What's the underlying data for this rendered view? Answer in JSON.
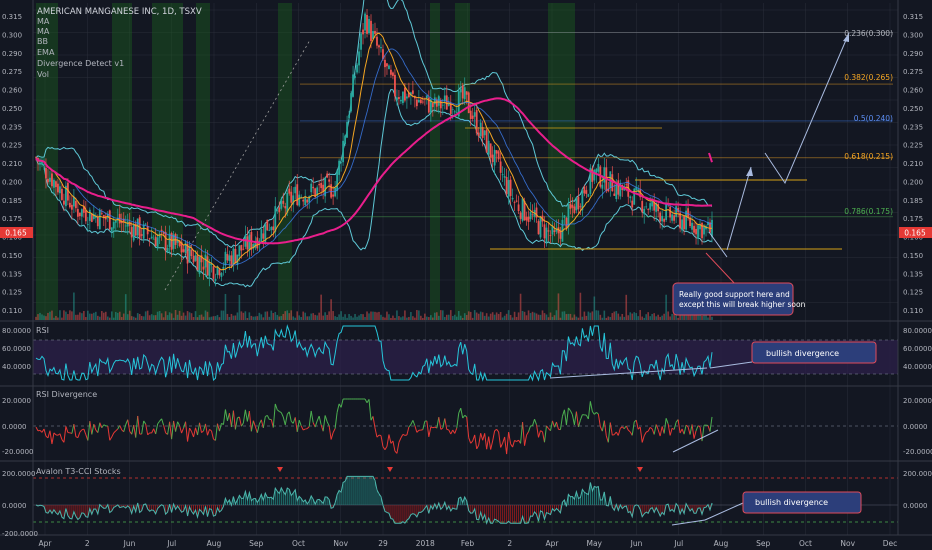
{
  "header": {
    "title": "AMERICAN MANGANESE INC, 1D, TSXV",
    "indicators": [
      "MA",
      "MA",
      "BB",
      "EMA",
      "Divergence Detect v1",
      "Vol"
    ]
  },
  "colors": {
    "background": "#131722",
    "grid": "#2a2e39",
    "text": "#b2b5be",
    "candle_up": "#26a69a",
    "candle_down": "#ef5350",
    "ema200": "#e91e8c",
    "bb": "#5ec8d6",
    "ma_fast": "#f5a623",
    "ma_slow": "#3d7ff2",
    "fib": "#d4a017",
    "rsi": "#26c6da",
    "rsi_band": "#2a1f47",
    "annotation_bg": "#2c3e7a",
    "annotation_border": "#e04b5a",
    "arrow": "#a9bbe0",
    "current_price_tag": "#e53935"
  },
  "x_axis": {
    "labels": [
      "Apr",
      "2",
      "Jun",
      "Jul",
      "Aug",
      "Sep",
      "Oct",
      "Nov",
      "29",
      "2018",
      "Feb",
      "2",
      "Apr",
      "May",
      "Jun",
      "Jul",
      "Aug",
      "Sep",
      "Oct",
      "Nov",
      "Dec"
    ]
  },
  "current_price": "0.165",
  "panels": {
    "price": {
      "ticks": [
        "0.315",
        "0.300",
        "0.290",
        "0.275",
        "0.260",
        "0.250",
        "0.235",
        "0.225",
        "0.210",
        "0.200",
        "0.185",
        "0.175",
        "0.160",
        "0.150",
        "0.135",
        "0.125",
        "0.110"
      ],
      "fib_levels": [
        {
          "label": "0.236(0.300)",
          "value": 0.3,
          "color": "#b2b5be"
        },
        {
          "label": "0.382(0.265)",
          "value": 0.265,
          "color": "#f5a623"
        },
        {
          "label": "0.5(0.240)",
          "value": 0.24,
          "color": "#3d7ff2"
        },
        {
          "label": "0.618(0.215)",
          "value": 0.215,
          "color": "#f5a623"
        },
        {
          "label": "0.786(0.175)",
          "value": 0.175,
          "color": "#4caf50"
        }
      ],
      "annotation": "Really good support here and except this will break higher soon"
    },
    "rsi": {
      "title": "RSI",
      "ticks_left": [
        "80.0000",
        "60.0000",
        "40.0000"
      ],
      "ticks_right": [
        "80.0000",
        "60.0000",
        "40.0000"
      ],
      "annotation": "bullish divergence"
    },
    "rsi_div": {
      "title": "RSI Divergence",
      "ticks_left": [
        "20.0000",
        "0.0000",
        "-20.0000"
      ],
      "ticks_right": [
        "20.0000",
        "0.0000",
        "-20.0000"
      ]
    },
    "t3cci": {
      "title": "Avalon T3-CCI Stocks",
      "ticks_left": [
        "200.0000",
        "0.0000",
        "-200.0000"
      ],
      "ticks_right": [
        "200.0000",
        "0.0000"
      ],
      "annotation": "bullish divergence"
    }
  },
  "chart_data": {
    "type": "line",
    "title": "AMERICAN MANGANESE INC, 1D, TSXV",
    "xlabel": "",
    "ylabel": "",
    "ylim": [
      0.105,
      0.32
    ],
    "grid": true,
    "x": [
      "Apr",
      "2",
      "Jun",
      "Jul",
      "Aug",
      "Sep",
      "Oct",
      "Nov",
      "29",
      "2018",
      "Feb",
      "2",
      "Apr",
      "May",
      "Jun",
      "Jul",
      "Aug"
    ],
    "series": [
      {
        "values": [
          0.215,
          0.18,
          0.17,
          0.155,
          0.14,
          0.16,
          0.19,
          0.195,
          0.31,
          0.26,
          0.25,
          0.255,
          0.185,
          0.16,
          0.205,
          0.18,
          0.165
        ]
      }
    ]
  }
}
